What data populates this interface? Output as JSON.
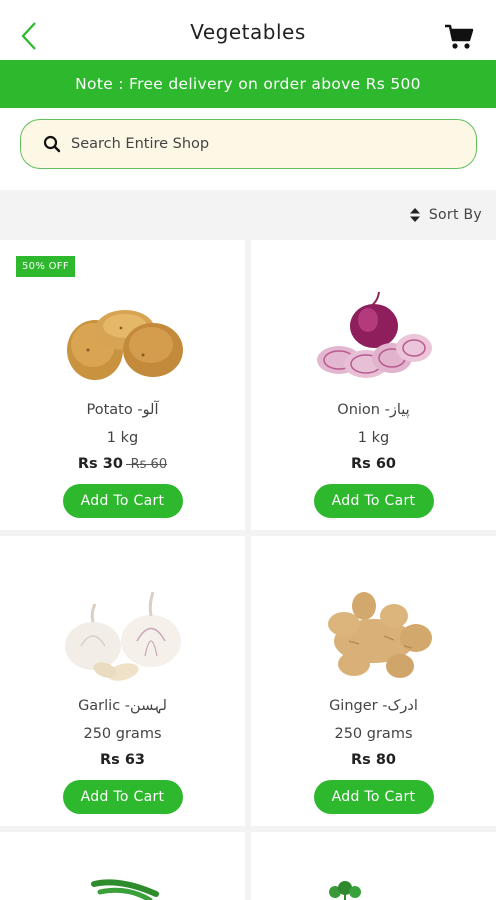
{
  "header": {
    "title": "Vegetables",
    "back_icon": "chevron-left-icon",
    "cart_icon": "shopping-cart-icon"
  },
  "note": "Note : Free delivery on order above Rs 500",
  "search": {
    "placeholder": "Search Entire Shop",
    "value": ""
  },
  "sort": {
    "label": "Sort By"
  },
  "products": [
    {
      "badge": "50% OFF",
      "name": "Potato -آلو",
      "qty": "1 kg",
      "price": "Rs 30",
      "old_price": "-Rs 60",
      "button": "Add To Cart",
      "image_icon": "potato-image"
    },
    {
      "badge": "",
      "name": "Onion -پیاز",
      "qty": "1 kg",
      "price": "Rs 60",
      "old_price": "",
      "button": "Add To Cart",
      "image_icon": "onion-image"
    },
    {
      "badge": "",
      "name": "Garlic -لہسن",
      "qty": "250 grams",
      "price": "Rs 63",
      "old_price": "",
      "button": "Add To Cart",
      "image_icon": "garlic-image"
    },
    {
      "badge": "",
      "name": "Ginger -ادرک",
      "qty": "250 grams",
      "price": "Rs 80",
      "old_price": "",
      "button": "Add To Cart",
      "image_icon": "ginger-image"
    }
  ],
  "colors": {
    "accent": "#2db82d",
    "search_bg": "#fdf7e6",
    "page_bg": "#f3f3f3"
  }
}
